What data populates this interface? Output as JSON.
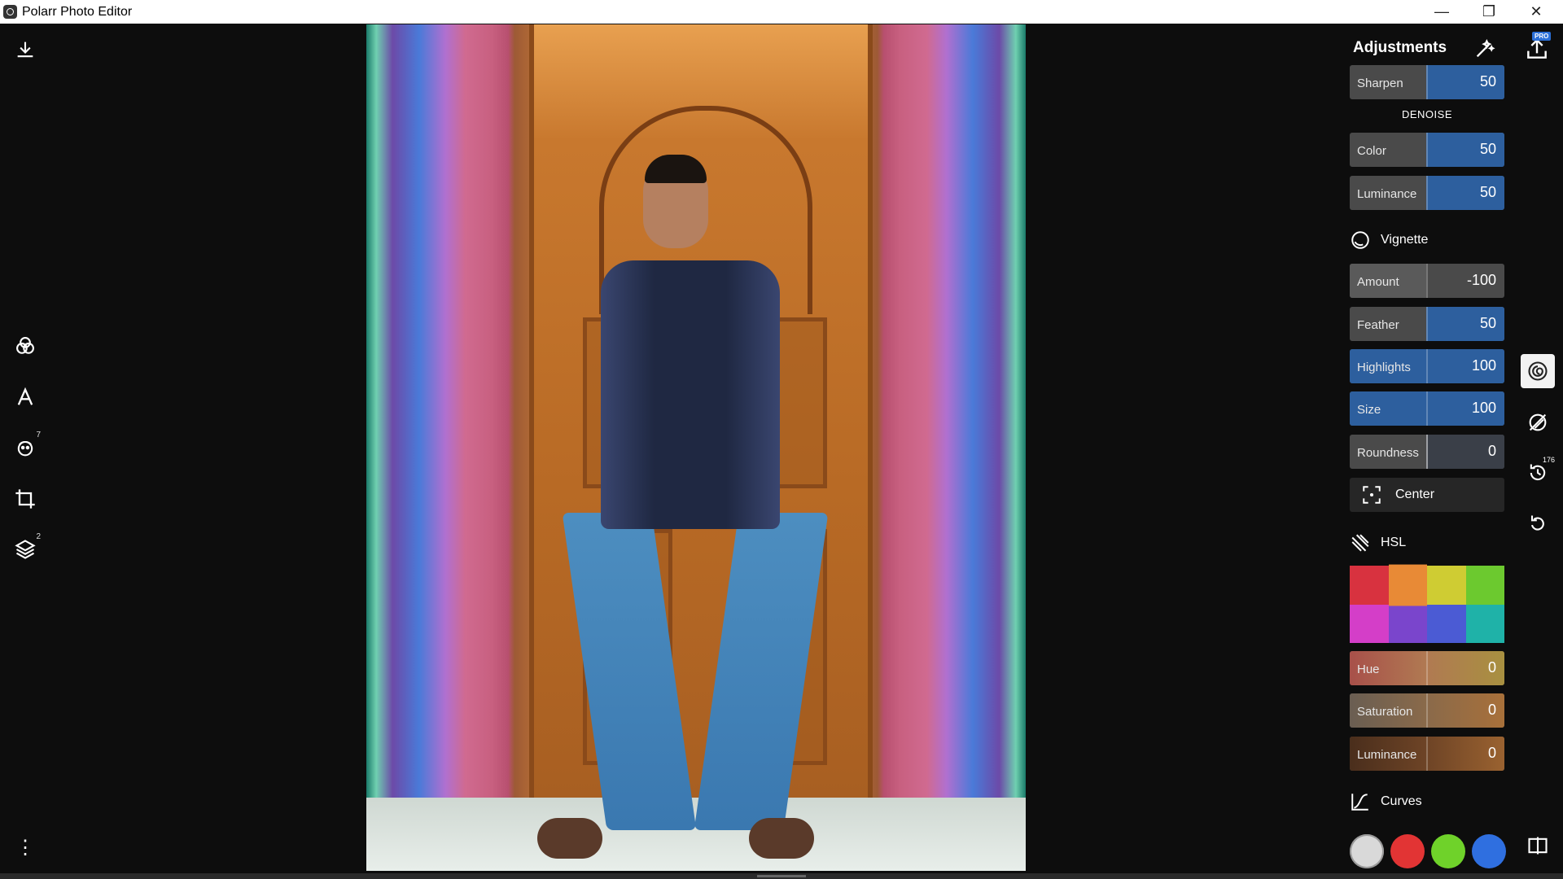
{
  "window": {
    "title": "Polarr Photo Editor",
    "minimize": "—",
    "maximize": "❐",
    "close": "✕"
  },
  "left_tools": {
    "face_count": "7",
    "layers_count": "2",
    "more": "⋮"
  },
  "panel": {
    "title": "Adjustments",
    "pro_badge": "PRO",
    "sharpen": {
      "label": "Sharpen",
      "value": "50"
    },
    "denoise_heading": "DENOISE",
    "denoise_color": {
      "label": "Color",
      "value": "50"
    },
    "denoise_luminance": {
      "label": "Luminance",
      "value": "50"
    },
    "vignette_heading": "Vignette",
    "vignette": {
      "amount": {
        "label": "Amount",
        "value": "-100"
      },
      "feather": {
        "label": "Feather",
        "value": "50"
      },
      "highlights": {
        "label": "Highlights",
        "value": "100"
      },
      "size": {
        "label": "Size",
        "value": "100"
      },
      "roundness": {
        "label": "Roundness",
        "value": "0"
      }
    },
    "center_label": "Center",
    "hsl_heading": "HSL",
    "hsl_swatches": [
      "#d8323f",
      "#e88a36",
      "#cfcc33",
      "#6cc92f",
      "#d43ec8",
      "#7a45cc",
      "#4b5bd4",
      "#1fb2a8"
    ],
    "hsl_selected": "orange",
    "hsl": {
      "hue": {
        "label": "Hue",
        "value": "0"
      },
      "saturation": {
        "label": "Saturation",
        "value": "0"
      },
      "luminance": {
        "label": "Luminance",
        "value": "0"
      }
    },
    "curves_heading": "Curves",
    "curve_channels": [
      "#d9d9d9",
      "#e23434",
      "#6fd22a",
      "#2f6fe0"
    ]
  },
  "right_tools": {
    "history_count": "176"
  },
  "colors": {
    "blue_fill": "#2d5f9e",
    "gray_fill": "#5a5a5a",
    "brown_fill": "#8a5a36",
    "hue_fill": "#b08850"
  }
}
